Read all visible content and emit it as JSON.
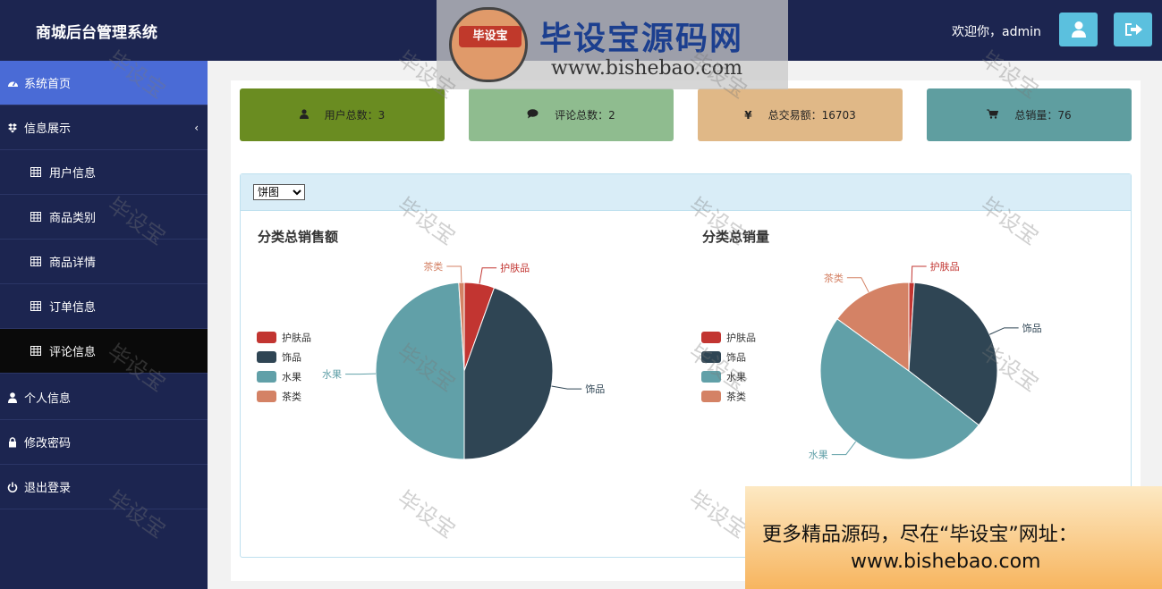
{
  "header": {
    "app_title": "商城后台管理系统",
    "welcome": "欢迎你，admin",
    "user_button_icon": "user-icon",
    "logout_button_icon": "sign-out-icon"
  },
  "sidebar": {
    "items": [
      {
        "label": "系统首页",
        "icon": "dashboard-icon"
      },
      {
        "label": "信息展示",
        "icon": "dropbox-icon"
      },
      {
        "label": "用户信息",
        "icon": "table-icon"
      },
      {
        "label": "商品类别",
        "icon": "table-icon"
      },
      {
        "label": "商品详情",
        "icon": "table-icon"
      },
      {
        "label": "订单信息",
        "icon": "table-icon"
      },
      {
        "label": "评论信息",
        "icon": "table-icon"
      },
      {
        "label": "个人信息",
        "icon": "user-icon"
      },
      {
        "label": "修改密码",
        "icon": "lock-icon"
      },
      {
        "label": "退出登录",
        "icon": "power-icon"
      }
    ],
    "caret": "‹"
  },
  "stats": [
    {
      "label": "用户总数：3",
      "icon": "user-icon",
      "color": "#6a8c21"
    },
    {
      "label": "评论总数：2",
      "icon": "comment-icon",
      "color": "#8fbc8f"
    },
    {
      "label": "总交易额：16703",
      "icon": "yen-icon",
      "color": "#e0b887"
    },
    {
      "label": "总销量：76",
      "icon": "cart-icon",
      "color": "#5f9ea0"
    }
  ],
  "chart_select": {
    "selected": "饼图"
  },
  "watermark": {
    "text": "毕设宝",
    "brand": "毕设宝源码网",
    "url": "www.bishebao.com",
    "promo_line1": "更多精品源码，尽在“毕设宝”网址：",
    "promo_line2": "www.bishebao.com"
  },
  "chart_data": [
    {
      "type": "pie",
      "title": "分类总销售额",
      "legend": [
        "护肤品",
        "饰品",
        "水果",
        "茶类"
      ],
      "legend_position": "left",
      "series": [
        {
          "name": "护肤品",
          "value": 5.5,
          "color": "#c23531"
        },
        {
          "name": "饰品",
          "value": 44.5,
          "color": "#2f4554"
        },
        {
          "name": "水果",
          "value": 49,
          "color": "#61a0a8"
        },
        {
          "name": "茶类",
          "value": 1,
          "color": "#d48265"
        }
      ]
    },
    {
      "type": "pie",
      "title": "分类总销量",
      "legend": [
        "护肤品",
        "饰品",
        "水果",
        "茶类"
      ],
      "legend_position": "left",
      "series": [
        {
          "name": "护肤品",
          "value": 1,
          "color": "#c23531"
        },
        {
          "name": "饰品",
          "value": 34.5,
          "color": "#2f4554"
        },
        {
          "name": "水果",
          "value": 49.5,
          "color": "#61a0a8"
        },
        {
          "name": "茶类",
          "value": 15,
          "color": "#d48265"
        }
      ]
    }
  ]
}
